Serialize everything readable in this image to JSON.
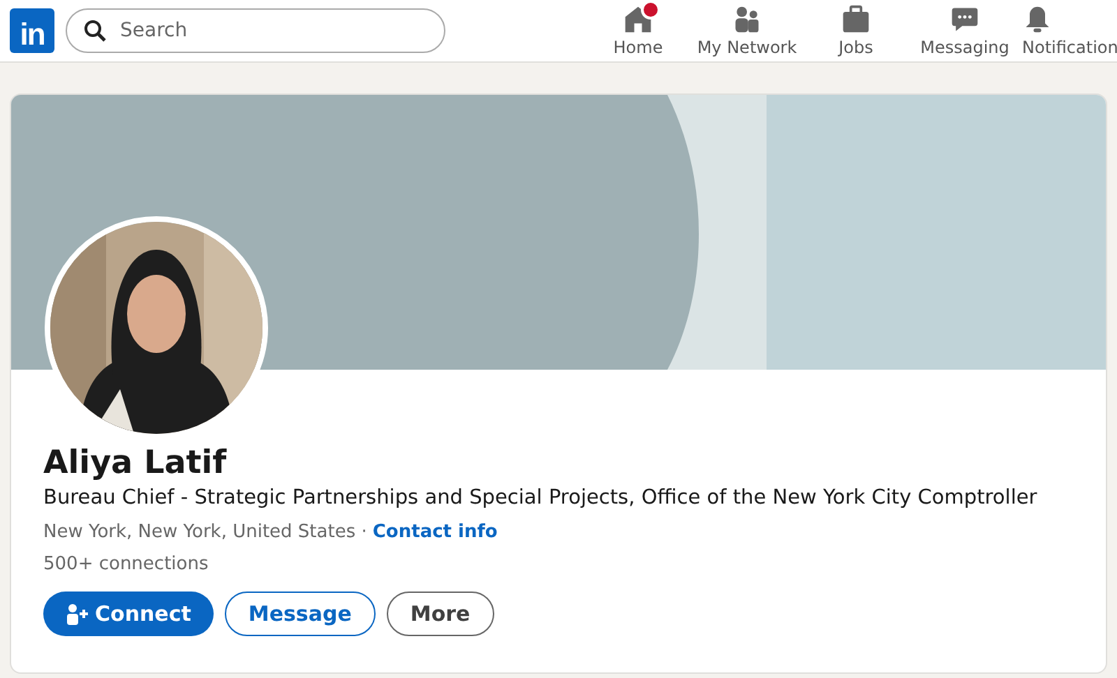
{
  "nav": {
    "logo": "in",
    "search": {
      "placeholder": "Search"
    },
    "items": [
      {
        "label": "Home",
        "kind": "home",
        "badge": true
      },
      {
        "label": "My Network",
        "kind": "network",
        "badge": false
      },
      {
        "label": "Jobs",
        "kind": "jobs",
        "badge": false
      },
      {
        "label": "Messaging",
        "kind": "messaging",
        "badge": false
      },
      {
        "label": "Notification",
        "kind": "bell",
        "badge": false
      }
    ]
  },
  "profile": {
    "name": "Aliya Latif",
    "headline": "Bureau Chief - Strategic Partnerships and Special Projects, Office of the New York City Comptroller",
    "location": "New York, New York, United States ·",
    "contact_link": "Contact info",
    "connections": "500+ connections",
    "buttons": [
      {
        "label": "Connect",
        "kind": "primary"
      },
      {
        "label": "Message",
        "kind": "outline"
      },
      {
        "label": "More",
        "kind": "neutral"
      }
    ]
  }
}
